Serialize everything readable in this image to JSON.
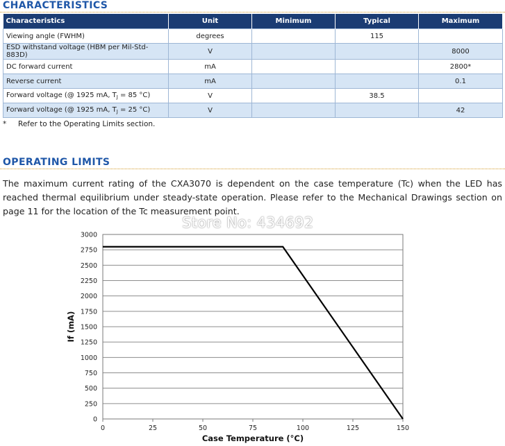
{
  "characteristics": {
    "title": "CHARACTERISTICS",
    "headers": [
      "Characteristics",
      "Unit",
      "Minimum",
      "Typical",
      "Maximum"
    ],
    "rows": [
      {
        "name": "Viewing angle (FWHM)",
        "unit": "degrees",
        "min": "",
        "typ": "115",
        "max": ""
      },
      {
        "name": "ESD withstand voltage (HBM per Mil-Std-883D)",
        "unit": "V",
        "min": "",
        "typ": "",
        "max": "8000"
      },
      {
        "name": "DC forward current",
        "unit": "mA",
        "min": "",
        "typ": "",
        "max": "2800*"
      },
      {
        "name": "Reverse current",
        "unit": "mA",
        "min": "",
        "typ": "",
        "max": "0.1"
      },
      {
        "name_pre": "Forward voltage (@ 1925 mA, T",
        "name_sub": "J",
        "name_post": " = 85 °C)",
        "unit": "V",
        "min": "",
        "typ": "38.5",
        "max": ""
      },
      {
        "name_pre": "Forward voltage (@ 1925 mA, T",
        "name_sub": "J",
        "name_post": " = 25 °C)",
        "unit": "V",
        "min": "",
        "typ": "",
        "max": "42"
      }
    ],
    "note_mark": "*",
    "note": "Refer to the Operating Limits section."
  },
  "operating_limits": {
    "title": "OPERATING LIMITS",
    "paragraph": "The maximum current rating of the CXA3070 is dependent on the case temperature (Tc) when the LED has reached thermal equilibrium under steady-state operation. Please refer to the Mechanical Drawings section on page 11 for the location of the Tc measurement point."
  },
  "watermark": "Store No: 434692",
  "chart_data": {
    "type": "line",
    "xlabel": "Case Temperature (°C)",
    "ylabel": "If (mA)",
    "xlim": [
      0,
      150
    ],
    "ylim": [
      0,
      3000
    ],
    "x_ticks": [
      0,
      25,
      50,
      75,
      100,
      125,
      150
    ],
    "y_ticks": [
      0,
      250,
      500,
      750,
      1000,
      1250,
      1500,
      1750,
      2000,
      2250,
      2500,
      2750,
      3000
    ],
    "grid": "horizontal",
    "series": [
      {
        "x": [
          0,
          90,
          150
        ],
        "y": [
          2800,
          2800,
          0
        ]
      }
    ]
  }
}
